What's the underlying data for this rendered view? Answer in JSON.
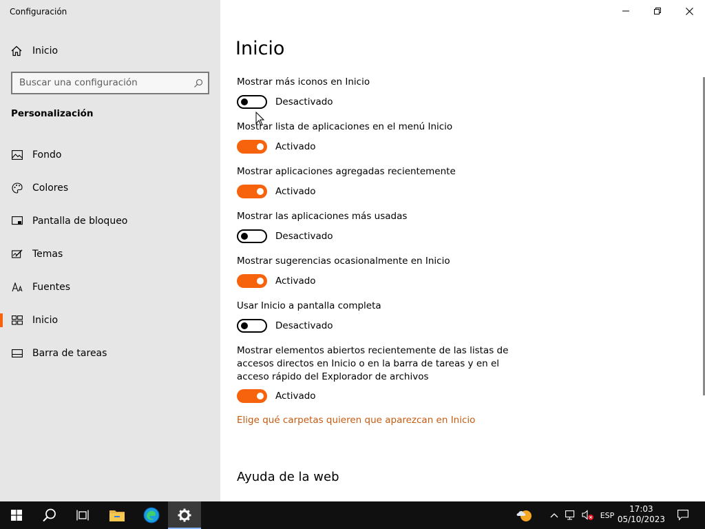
{
  "window": {
    "app_title": "Configuración"
  },
  "sidebar": {
    "home_label": "Inicio",
    "search_placeholder": "Buscar una configuración",
    "section_title": "Personalización",
    "items": [
      {
        "label": "Fondo",
        "icon": "picture-icon"
      },
      {
        "label": "Colores",
        "icon": "palette-icon"
      },
      {
        "label": "Pantalla de bloqueo",
        "icon": "lock-screen-icon"
      },
      {
        "label": "Temas",
        "icon": "themes-icon"
      },
      {
        "label": "Fuentes",
        "icon": "fonts-icon"
      },
      {
        "label": "Inicio",
        "icon": "start-icon",
        "active": true
      },
      {
        "label": "Barra de tareas",
        "icon": "taskbar-icon"
      }
    ]
  },
  "main": {
    "title": "Inicio",
    "settings": [
      {
        "label": "Mostrar más iconos en Inicio",
        "state": "Desactivado",
        "on": false
      },
      {
        "label": "Mostrar lista de aplicaciones en el menú Inicio",
        "state": "Activado",
        "on": true
      },
      {
        "label": "Mostrar aplicaciones agregadas recientemente",
        "state": "Activado",
        "on": true
      },
      {
        "label": "Mostrar las aplicaciones más usadas",
        "state": "Desactivado",
        "on": false
      },
      {
        "label": "Mostrar sugerencias ocasionalmente en Inicio",
        "state": "Activado",
        "on": true
      },
      {
        "label": "Usar Inicio a pantalla completa",
        "state": "Desactivado",
        "on": false
      },
      {
        "label": "Mostrar elementos abiertos recientemente de las listas de accesos directos en Inicio o en la barra de tareas y en el acceso rápido del Explorador de archivos",
        "state": "Activado",
        "on": true
      }
    ],
    "link": "Elige qué carpetas quieren que aparezcan en Inicio",
    "help_heading": "Ayuda de la web"
  },
  "taskbar": {
    "language": "ESP",
    "time": "17:03",
    "date": "05/10/2023"
  },
  "colors": {
    "accent": "#f7630c",
    "sidebar_bg": "#e6e6e6",
    "taskbar_bg": "#101010",
    "link": "#c55a11"
  }
}
